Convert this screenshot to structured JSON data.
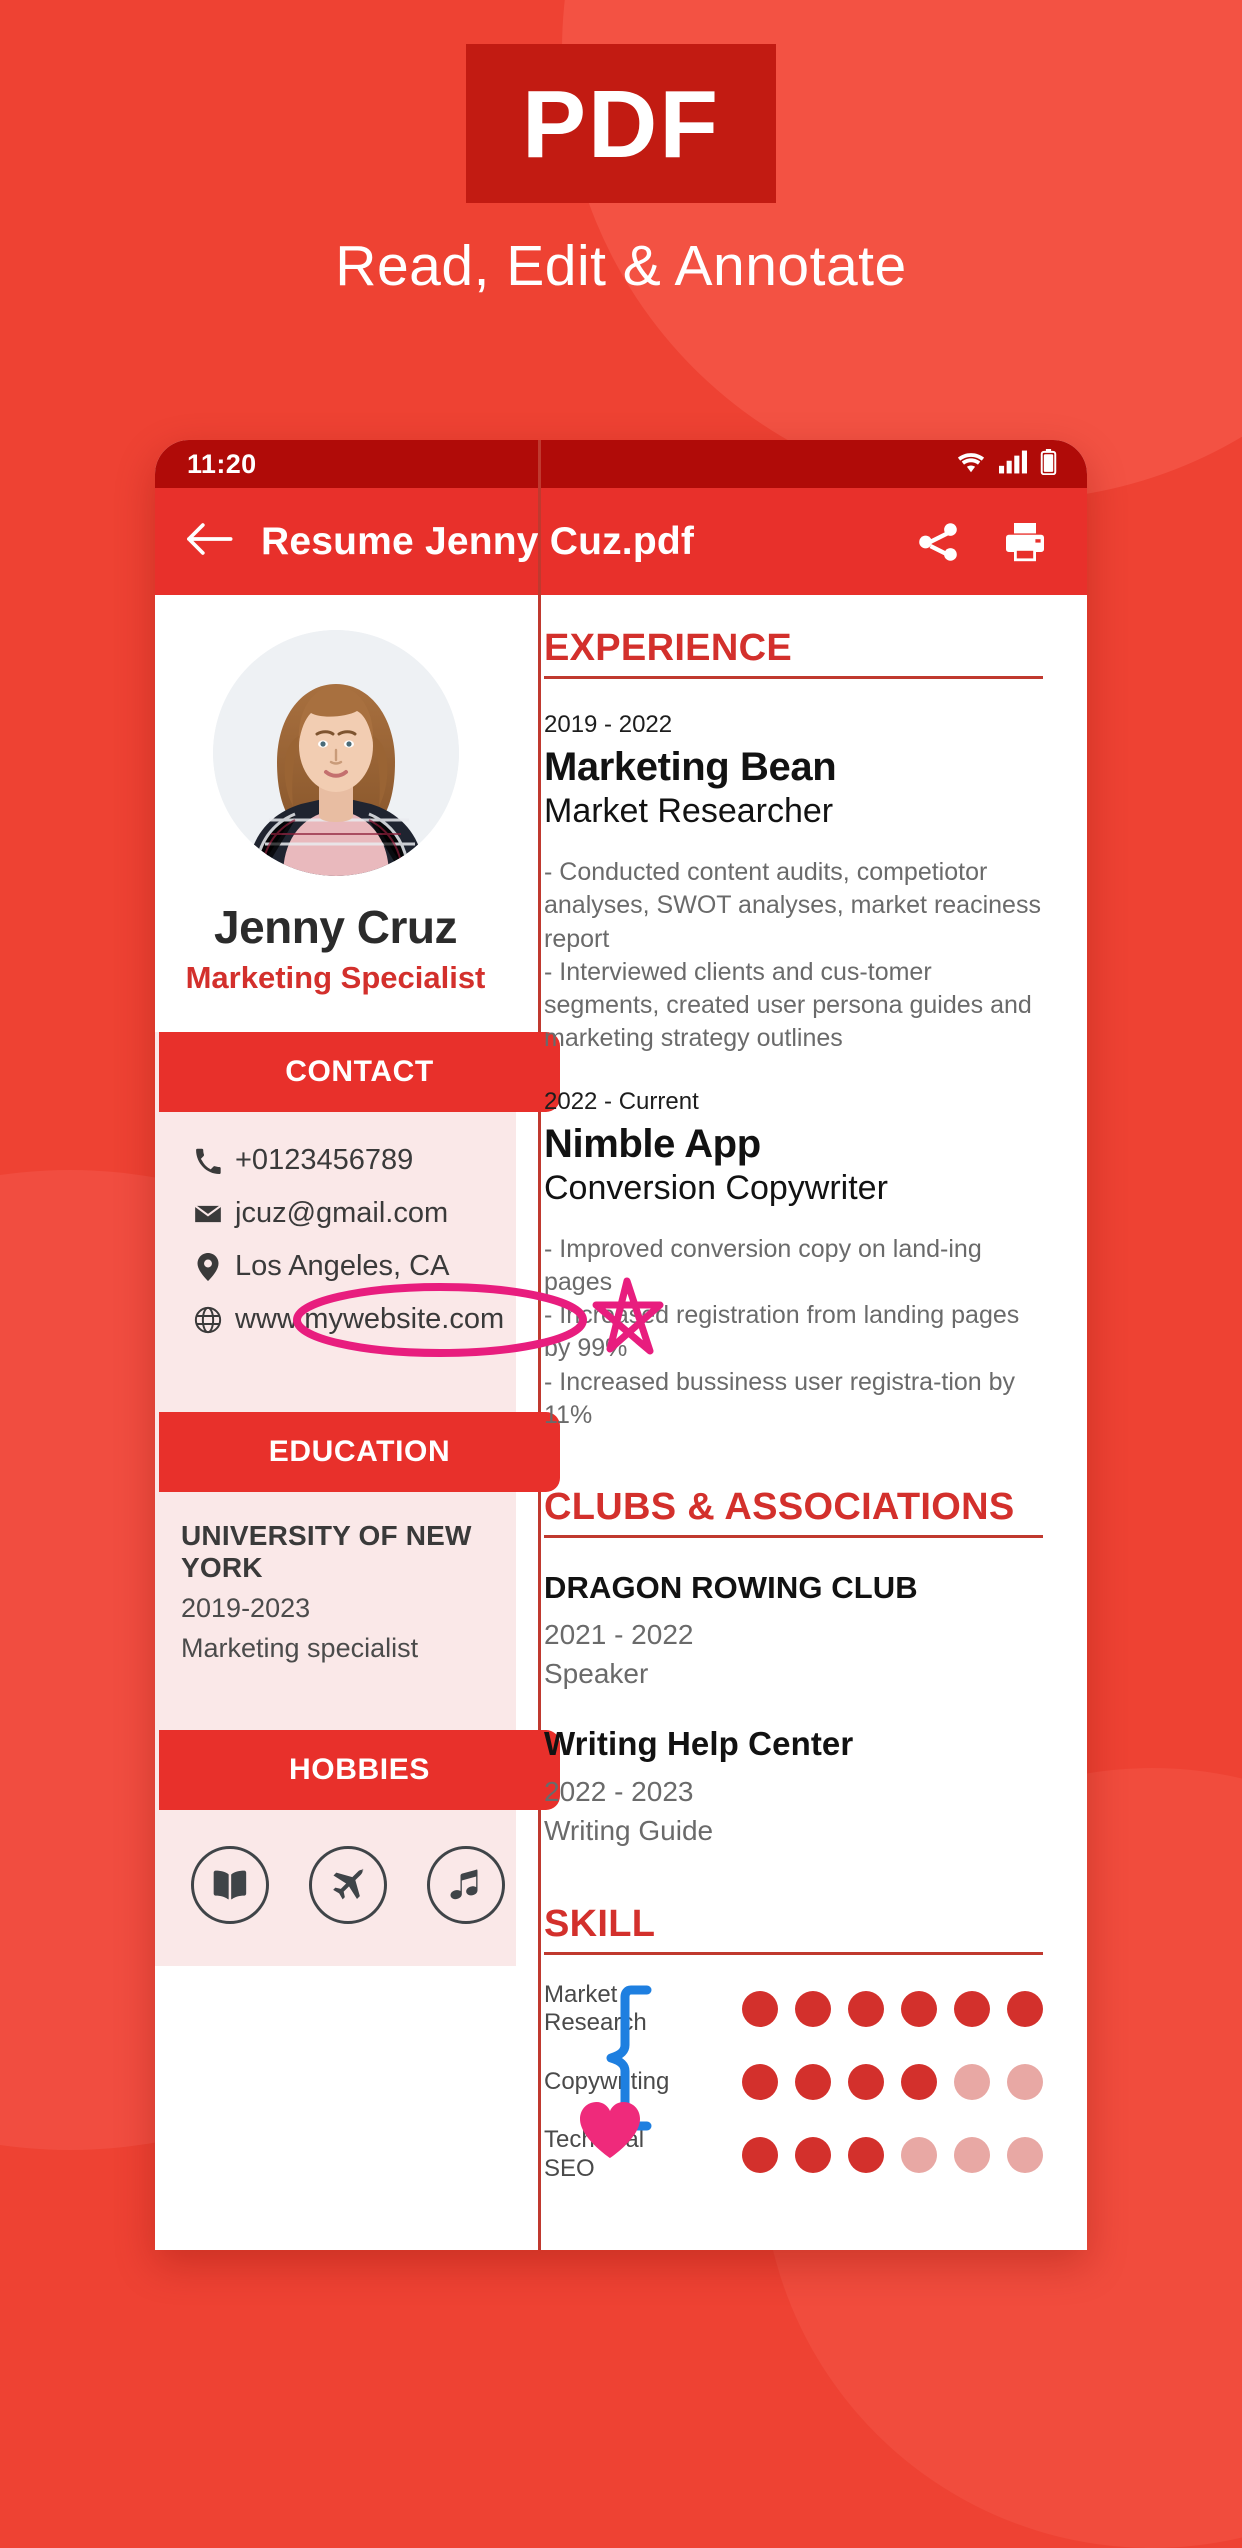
{
  "hero": {
    "badge": "PDF",
    "subtitle": "Read, Edit & Annotate"
  },
  "colors": {
    "background": "#ee4233",
    "badge_bg": "#c21b12",
    "statusbar_bg": "#b00b08",
    "appbar_bg": "#e8302b",
    "accent_red": "#d3302c",
    "panel_pink": "#fae8e8",
    "dot_filled": "#d3302c",
    "dot_empty": "#e8a8a4",
    "annotation_pink": "#e81d7e",
    "annotation_blue": "#1e7fe0"
  },
  "phone": {
    "statusbar": {
      "time": "11:20",
      "icons": [
        "wifi-icon",
        "signal-icon",
        "battery-icon"
      ]
    },
    "appbar": {
      "back_icon": "back-arrow-icon",
      "title": "Resume Jenny Cuz.pdf",
      "share_icon": "share-icon",
      "print_icon": "print-icon"
    }
  },
  "resume": {
    "profile": {
      "name": "Jenny Cruz",
      "role": "Marketing Specialist",
      "photo_alt": "profile-photo"
    },
    "contact": {
      "heading": "CONTACT",
      "items": [
        {
          "icon": "phone-icon",
          "value": "+0123456789"
        },
        {
          "icon": "email-icon",
          "value": "jcuz@gmail.com"
        },
        {
          "icon": "location-icon",
          "value": "Los Angeles, CA"
        },
        {
          "icon": "globe-icon",
          "value": "www.mywebsite.com"
        }
      ]
    },
    "education": {
      "heading": "EDUCATION",
      "school": "UNIVERSITY OF NEW YORK",
      "years": "2019-2023",
      "major": "Marketing specialist"
    },
    "hobbies": {
      "heading": "HOBBIES",
      "items": [
        "book-icon",
        "airplane-icon",
        "music-note-icon"
      ]
    },
    "experience": {
      "heading": "EXPERIENCE",
      "jobs": [
        {
          "date": "2019 - 2022",
          "org": "Marketing Bean",
          "title": "Market Researcher",
          "bullets": "- Conducted content audits, competiotor analyses, SWOT analyses, market reaciness report\n-  Interviewed clients and cus-tomer segments, created user persona guides and marketing strategy outlines"
        },
        {
          "date": "2022 - Current",
          "org": "Nimble App",
          "title": "Conversion Copywriter",
          "bullets": "- Improved conversion copy on land-ing pages\n- Increased registration from landing pages by 99%\n- Increased bussiness user registra-tion by 11%"
        }
      ]
    },
    "clubs": {
      "heading": "CLUBS & ASSOCIATIONS",
      "entries": [
        {
          "name": "DRAGON ROWING CLUB",
          "meta": "2021 - 2022\nSpeaker"
        },
        {
          "name": "Writing Help Center",
          "meta": "2022 - 2023\nWriting Guide"
        }
      ]
    },
    "skills": {
      "heading": "SKILL",
      "max": 6,
      "items": [
        {
          "label": "Market\nResearch",
          "level": 6
        },
        {
          "label": "Copywriting",
          "level": 4
        },
        {
          "label": "Technical\nSEO",
          "level": 3
        }
      ]
    }
  },
  "annotations": [
    {
      "name": "ellipse-annotation",
      "color": "#e81d7e"
    },
    {
      "name": "star-annotation",
      "color": "#e81d7e"
    },
    {
      "name": "brace-annotation",
      "color": "#1e7fe0"
    },
    {
      "name": "heart-sticker",
      "color": "#ef2a7b"
    }
  ]
}
